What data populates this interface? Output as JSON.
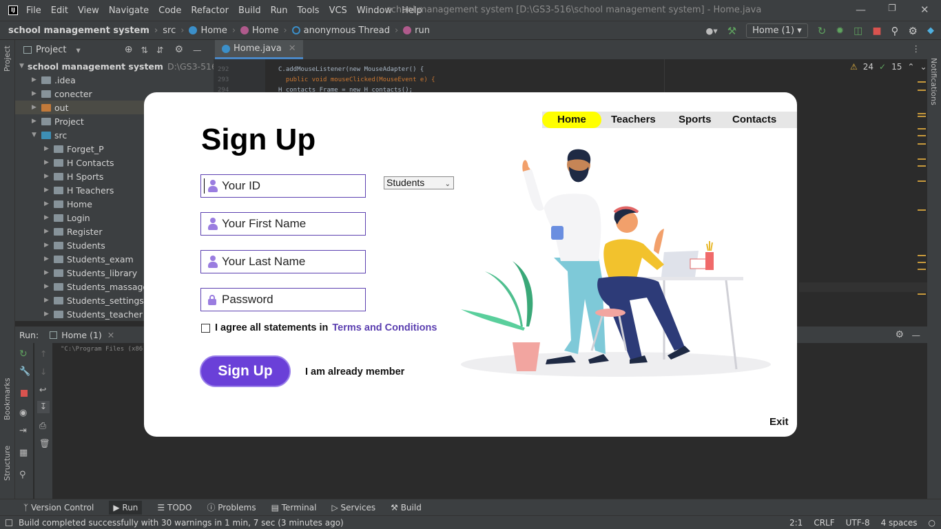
{
  "ide": {
    "menu": [
      "File",
      "Edit",
      "View",
      "Navigate",
      "Code",
      "Refactor",
      "Build",
      "Run",
      "Tools",
      "VCS",
      "Window",
      "Help"
    ],
    "window_title": "school management system [D:\\GS3-516\\school management system] - Home.java",
    "breadcrumbs": [
      "school management system",
      "src",
      "Home",
      "Home",
      "anonymous Thread",
      "run"
    ],
    "run_config": "Home (1)",
    "project_label": "Project",
    "project_root": "school management system",
    "project_root_path": "D:\\GS3-516\\scho",
    "tree_items": [
      {
        "label": ".idea",
        "depth": 1,
        "color": "#87939a"
      },
      {
        "label": "conecter",
        "depth": 1,
        "color": "#87939a"
      },
      {
        "label": "out",
        "depth": 1,
        "color": "#c27a3a"
      },
      {
        "label": "Project",
        "depth": 1,
        "color": "#87939a"
      },
      {
        "label": "src",
        "depth": 1,
        "color": "#3d8fb5",
        "open": true
      },
      {
        "label": "Forget_P",
        "depth": 2,
        "color": "#87939a"
      },
      {
        "label": "H Contacts",
        "depth": 2,
        "color": "#87939a"
      },
      {
        "label": "H Sports",
        "depth": 2,
        "color": "#87939a"
      },
      {
        "label": "H Teachers",
        "depth": 2,
        "color": "#87939a"
      },
      {
        "label": "Home",
        "depth": 2,
        "color": "#87939a"
      },
      {
        "label": "Login",
        "depth": 2,
        "color": "#87939a"
      },
      {
        "label": "Register",
        "depth": 2,
        "color": "#87939a"
      },
      {
        "label": "Students",
        "depth": 2,
        "color": "#87939a"
      },
      {
        "label": "Students_exam",
        "depth": 2,
        "color": "#87939a"
      },
      {
        "label": "Students_library",
        "depth": 2,
        "color": "#87939a"
      },
      {
        "label": "Students_massage",
        "depth": 2,
        "color": "#87939a"
      },
      {
        "label": "Students_settings",
        "depth": 2,
        "color": "#87939a"
      },
      {
        "label": "Students_teacher",
        "depth": 2,
        "color": "#87939a"
      }
    ],
    "editor_tab": "Home.java",
    "warnings": "24",
    "checks": "15",
    "code_lines": [
      {
        "num": "292",
        "text": "C.addMouseListener(new MouseAdapter() {"
      },
      {
        "num": "293",
        "text": "  public void mouseClicked(MouseEvent e) {"
      },
      {
        "num": "294",
        "text": "H_contacts Frame = new H_contacts();"
      }
    ],
    "run_label": "Run:",
    "run_tab": "Home (1)",
    "console_text": "\"C:\\Program Files (x86)\\",
    "left_strip": [
      "Project",
      "Bookmarks",
      "Structure"
    ],
    "right_strip": "Notifications",
    "bottom_tabs": [
      "Version Control",
      "Run",
      "TODO",
      "Problems",
      "Terminal",
      "Services",
      "Build"
    ],
    "status_message": "Build completed successfully with 30 warnings in 1 min, 7 sec (3 minutes ago)",
    "status_right": [
      "2:1",
      "CRLF",
      "UTF-8",
      "4 spaces"
    ]
  },
  "app": {
    "nav": [
      "Home",
      "Teachers",
      "Sports",
      "Contacts"
    ],
    "title": "Sign Up",
    "fields": {
      "id_placeholder": "Your ID",
      "first_name_placeholder": "Your First Name",
      "last_name_placeholder": "Your Last Name",
      "password_placeholder": "Password"
    },
    "role_select": "Students",
    "agree_text": "I agree all statements in",
    "terms_link": "Terms and Conditions",
    "signup_button": "Sign Up",
    "member_link": "I am already member",
    "exit": "Exit",
    "colors": {
      "accent": "#6a40d8",
      "nav_active": "#ffff00"
    }
  }
}
